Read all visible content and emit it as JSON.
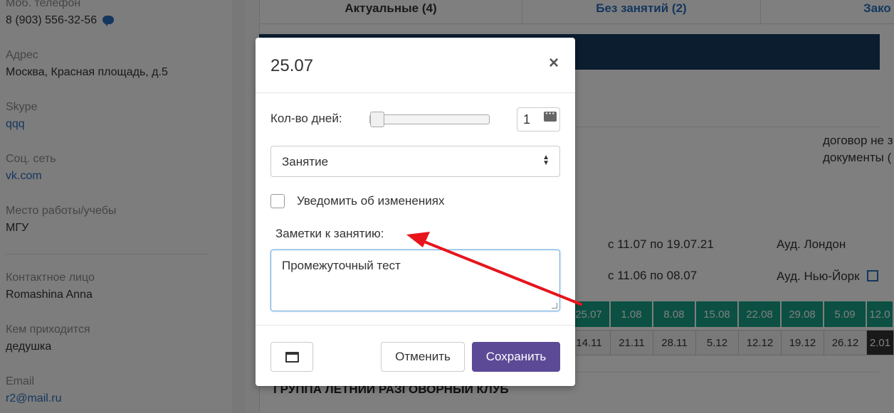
{
  "profile": {
    "phone_label": "Моб. телефон",
    "phone_value": "8 (903) 556-32-56",
    "address_label": "Адрес",
    "address_value": "Москва, Красная площадь, д.5",
    "skype_label": "Skype",
    "skype_value": "qqq",
    "social_label": "Соц. сеть",
    "social_value": "vk.com",
    "work_label": "Место работы/учебы",
    "work_value": "МГУ",
    "contact_label": "Контактное лицо",
    "contact_value": "Romashina Anna",
    "relation_label": "Кем приходится",
    "relation_value": "дедушка",
    "email_label": "Email",
    "email_value": "r2@mail.ru"
  },
  "tabs": [
    {
      "label": "Актуальные (4)"
    },
    {
      "label": "Без занятий (2)"
    },
    {
      "label": "Зако"
    }
  ],
  "main": {
    "contract_line1": "договор не з",
    "contract_line2": "документы (",
    "period1": "с 11.07 по 19.07.21",
    "room1": "Ауд. Лондон",
    "period2": "с 11.06 по 08.07",
    "room2": "Ауд. Нью-Йорк",
    "dates_top": [
      "25.07",
      "1.08",
      "8.08",
      "15.08",
      "22.08",
      "29.08",
      "5.09",
      "12.0"
    ],
    "dates_bottom": [
      "14.11",
      "21.11",
      "28.11",
      "5.12",
      "12.12",
      "19.12",
      "26.12",
      "2.01"
    ],
    "group_title": "ГРУППА ЛЕТНИЙ РАЗГОВОРНЫЙ КЛУБ"
  },
  "modal": {
    "title": "25.07",
    "close": "×",
    "days_label": "Кол-во дней:",
    "days_value": "1",
    "select_value": "Занятие",
    "notify_label": "Уведомить об изменениях",
    "notes_label": "Заметки к занятию:",
    "notes_value": "Промежуточный тест",
    "cancel_label": "Отменить",
    "save_label": "Сохранить"
  },
  "colors": {
    "accent": "#5d4a97",
    "teal": "#16a085",
    "navy": "#173a5e",
    "arrow": "#e8141c"
  }
}
